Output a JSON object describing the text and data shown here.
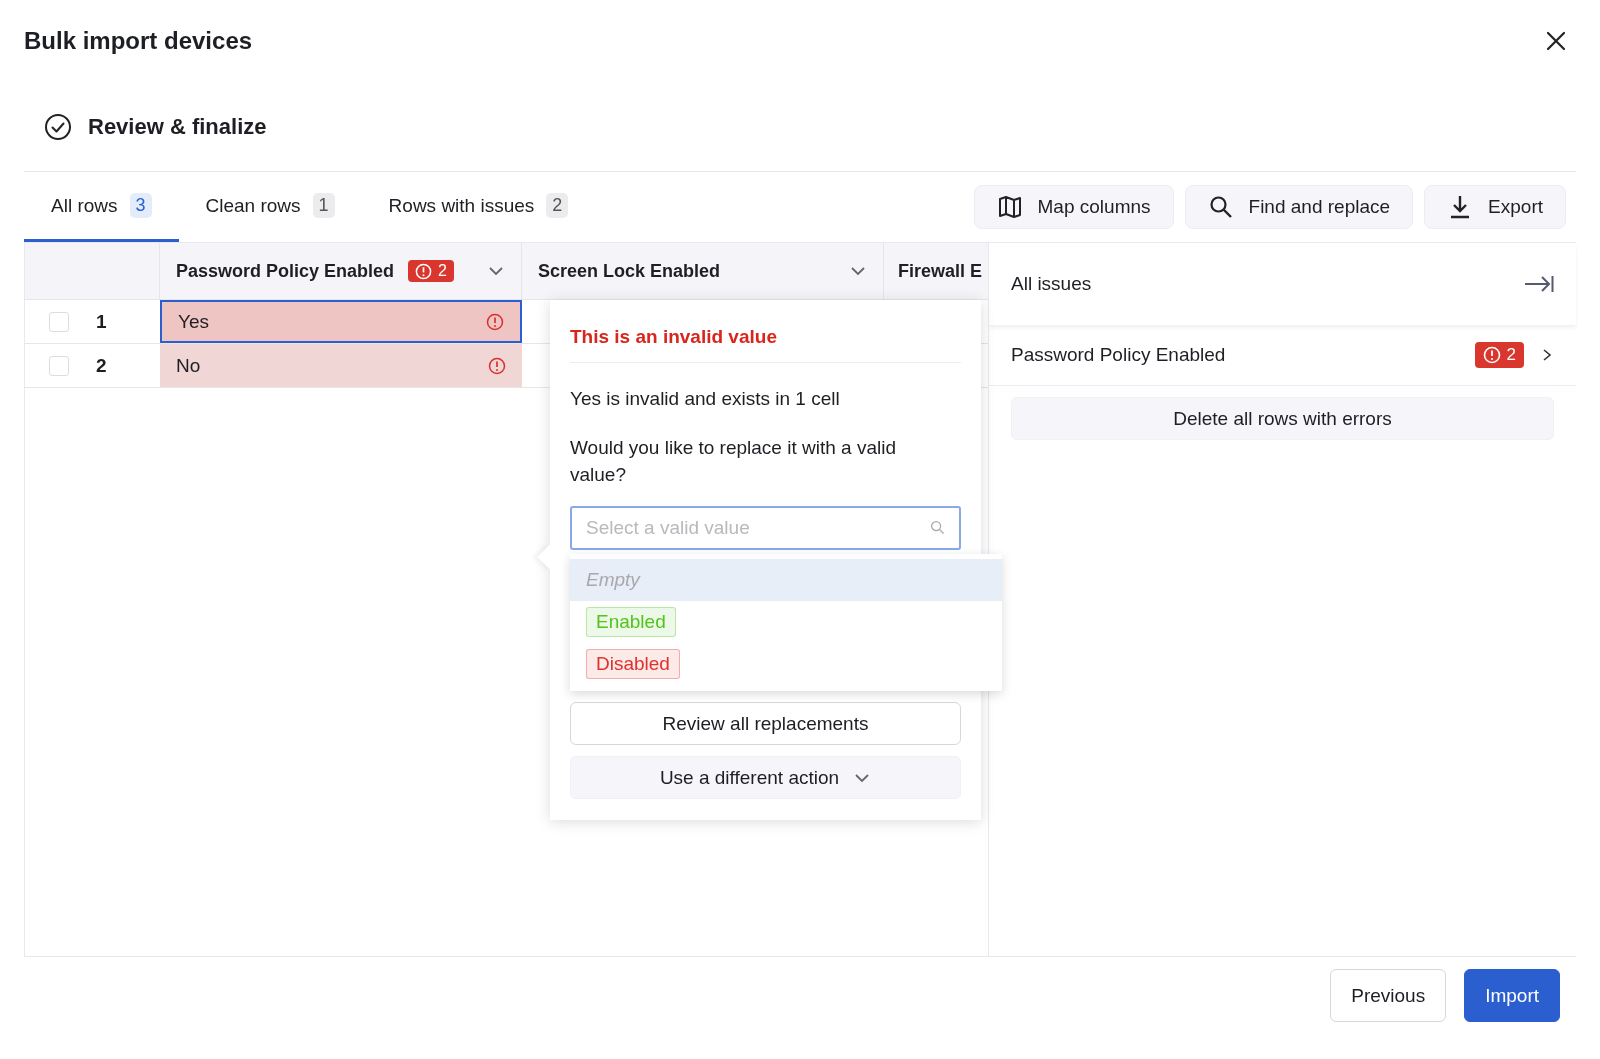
{
  "dialog": {
    "title": "Bulk import devices"
  },
  "step": {
    "label": "Review & finalize",
    "completed": true
  },
  "tabs": [
    {
      "label": "All rows",
      "count": "3",
      "selected": true
    },
    {
      "label": "Clean rows",
      "count": "1",
      "selected": false
    },
    {
      "label": "Rows with issues",
      "count": "2",
      "selected": false
    }
  ],
  "toolbar": [
    {
      "label": "Map columns",
      "kind": "map"
    },
    {
      "label": "Find and replace",
      "kind": "search"
    },
    {
      "label": "Export",
      "kind": "download"
    }
  ],
  "table": {
    "columns": [
      {
        "label": "Password Policy Enabled",
        "error_count": "2"
      },
      {
        "label": "Screen Lock Enabled"
      },
      {
        "label": "Firewall E"
      }
    ],
    "rows": [
      {
        "number": "1",
        "checked": false,
        "cells": [
          {
            "value": "Yes",
            "invalid": true,
            "selected": true
          }
        ]
      },
      {
        "number": "2",
        "checked": false,
        "cells": [
          {
            "value": "No",
            "invalid": true,
            "selected": false
          }
        ]
      }
    ]
  },
  "popover": {
    "title": "This is an invalid value",
    "message": "Yes is invalid and exists in 1 cell",
    "question": "Would you like to replace it with a valid value?",
    "search": {
      "placeholder": "Select a valid value"
    },
    "options": [
      {
        "label": "Empty",
        "kind": "empty",
        "selected": true
      },
      {
        "label": "Enabled",
        "kind": "tag",
        "color": "#52c41a",
        "selected": false
      },
      {
        "label": "Disabled",
        "kind": "tag",
        "color": "#e0312b",
        "selected": false
      }
    ],
    "buttons": [
      {
        "label": "Review all replacements",
        "kind": "outline"
      },
      {
        "label": "Use a different action",
        "kind": "menu"
      }
    ]
  },
  "issues_panel": {
    "title": "All issues",
    "issues": [
      {
        "label": "Password Policy Enabled",
        "count": "2"
      }
    ],
    "action": "Delete all rows with errors"
  },
  "footer": {
    "buttons": [
      {
        "label": "Previous",
        "kind": "secondary"
      },
      {
        "label": "Import",
        "kind": "primary"
      }
    ]
  }
}
